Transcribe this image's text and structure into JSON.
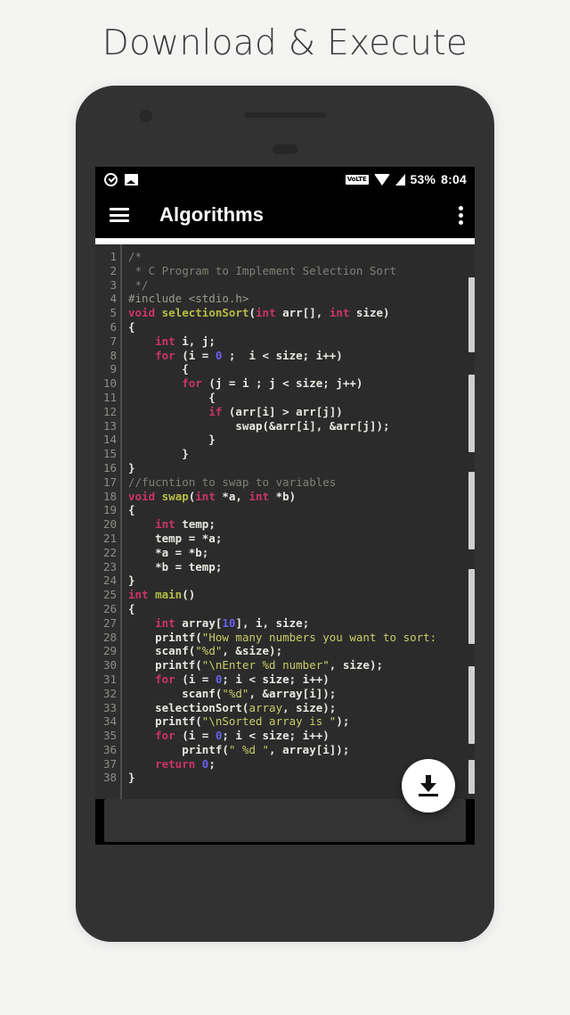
{
  "promo": {
    "title": "Download & Execute"
  },
  "device": {
    "camera_icon": "camera-dot",
    "speaker_icon": "speaker-grille",
    "sensor_icon": "proximity-sensor"
  },
  "statusbar": {
    "left_icons": [
      {
        "name": "check-circle-icon",
        "label": "task-complete"
      },
      {
        "name": "photo-icon",
        "label": "screenshot-saved"
      }
    ],
    "volte_badge": "VoLTE",
    "wifi_icon": "wifi-icon",
    "signal_icon": "signal-bars-icon",
    "battery": "53%",
    "time": "8:04"
  },
  "appbar": {
    "menu_icon": "hamburger-menu-icon",
    "title": "Algorithms",
    "overflow_icon": "overflow-menu-icon"
  },
  "fab": {
    "icon": "download-icon",
    "label": "Download"
  },
  "editor": {
    "language": "c",
    "first_line": 1,
    "last_line": 38,
    "line_numbers": [
      1,
      2,
      3,
      4,
      5,
      6,
      7,
      8,
      9,
      10,
      11,
      12,
      13,
      14,
      15,
      16,
      17,
      18,
      19,
      20,
      21,
      22,
      23,
      24,
      25,
      26,
      27,
      28,
      29,
      30,
      31,
      32,
      33,
      34,
      35,
      36,
      37,
      38
    ],
    "colors": {
      "background": "#2b2b2b",
      "gutter_background": "#2e2e2e",
      "gutter_text": "#8d8d87",
      "default_text": "#e8e8e2",
      "comment": "#808078",
      "preprocessor": "#9a9a92",
      "keyword": "#cc3366",
      "function": "#b5bd45",
      "string": "#c8cc68",
      "number": "#6b5ef0"
    },
    "lines": [
      [
        {
          "t": "/*",
          "c": "comment"
        }
      ],
      [
        {
          "t": " * C Program to Implement Selection Sort",
          "c": "comment"
        }
      ],
      [
        {
          "t": " */",
          "c": "comment"
        }
      ],
      [
        {
          "t": "#include <stdio.h>",
          "c": "preproc"
        }
      ],
      [
        {
          "t": "void ",
          "c": "kw"
        },
        {
          "t": "selectionSort",
          "c": "fn"
        },
        {
          "t": "(",
          "c": "plain"
        },
        {
          "t": "int",
          "c": "kw"
        },
        {
          "t": " arr[], ",
          "c": "plain"
        },
        {
          "t": "int",
          "c": "kw"
        },
        {
          "t": " size)",
          "c": "plain"
        }
      ],
      [
        {
          "t": "{",
          "c": "plain"
        }
      ],
      [
        {
          "t": "    ",
          "c": "plain"
        },
        {
          "t": "int",
          "c": "kw"
        },
        {
          "t": " i, j;",
          "c": "plain"
        }
      ],
      [
        {
          "t": "    ",
          "c": "plain"
        },
        {
          "t": "for",
          "c": "kw"
        },
        {
          "t": " (i = ",
          "c": "plain"
        },
        {
          "t": "0",
          "c": "num"
        },
        {
          "t": " ;  i < size; i++)",
          "c": "plain"
        }
      ],
      [
        {
          "t": "        {",
          "c": "plain"
        }
      ],
      [
        {
          "t": "        ",
          "c": "plain"
        },
        {
          "t": "for",
          "c": "kw"
        },
        {
          "t": " (j = i ; j < size; j++)",
          "c": "plain"
        }
      ],
      [
        {
          "t": "            {",
          "c": "plain"
        }
      ],
      [
        {
          "t": "            ",
          "c": "plain"
        },
        {
          "t": "if",
          "c": "kw"
        },
        {
          "t": " (arr[i] > arr[j])",
          "c": "plain"
        }
      ],
      [
        {
          "t": "                swap(&arr[i], &arr[j]);",
          "c": "plain"
        }
      ],
      [
        {
          "t": "            }",
          "c": "plain"
        }
      ],
      [
        {
          "t": "        }",
          "c": "plain"
        }
      ],
      [
        {
          "t": "}",
          "c": "plain"
        }
      ],
      [
        {
          "t": "//fucntion to swap to variables",
          "c": "comment"
        }
      ],
      [
        {
          "t": "void ",
          "c": "kw"
        },
        {
          "t": "swap",
          "c": "fn"
        },
        {
          "t": "(",
          "c": "plain"
        },
        {
          "t": "int",
          "c": "kw"
        },
        {
          "t": " *a, ",
          "c": "plain"
        },
        {
          "t": "int",
          "c": "kw"
        },
        {
          "t": " *b)",
          "c": "plain"
        }
      ],
      [
        {
          "t": "{",
          "c": "plain"
        }
      ],
      [
        {
          "t": "    ",
          "c": "plain"
        },
        {
          "t": "int",
          "c": "kw"
        },
        {
          "t": " temp;",
          "c": "plain"
        }
      ],
      [
        {
          "t": "    temp = *a;",
          "c": "plain"
        }
      ],
      [
        {
          "t": "    *a = *b;",
          "c": "plain"
        }
      ],
      [
        {
          "t": "    *b = temp;",
          "c": "plain"
        }
      ],
      [
        {
          "t": "}",
          "c": "plain"
        }
      ],
      [
        {
          "t": "int",
          "c": "kw"
        },
        {
          "t": " ",
          "c": "plain"
        },
        {
          "t": "main",
          "c": "fn"
        },
        {
          "t": "()",
          "c": "plain"
        }
      ],
      [
        {
          "t": "{",
          "c": "plain"
        }
      ],
      [
        {
          "t": "    ",
          "c": "plain"
        },
        {
          "t": "int",
          "c": "kw"
        },
        {
          "t": " array[",
          "c": "plain"
        },
        {
          "t": "10",
          "c": "num"
        },
        {
          "t": "], i, size;",
          "c": "plain"
        }
      ],
      [
        {
          "t": "    printf(",
          "c": "plain"
        },
        {
          "t": "\"How many numbers you want to sort: ",
          "c": "str"
        }
      ],
      [
        {
          "t": "    scanf(",
          "c": "plain"
        },
        {
          "t": "\"%d\"",
          "c": "str"
        },
        {
          "t": ", &size);",
          "c": "plain"
        }
      ],
      [
        {
          "t": "    printf(",
          "c": "plain"
        },
        {
          "t": "\"\\nEnter %d number\"",
          "c": "str"
        },
        {
          "t": ", size);",
          "c": "plain"
        }
      ],
      [
        {
          "t": "    ",
          "c": "plain"
        },
        {
          "t": "for",
          "c": "kw"
        },
        {
          "t": " (i = ",
          "c": "plain"
        },
        {
          "t": "0",
          "c": "num"
        },
        {
          "t": "; i < size; i++)",
          "c": "plain"
        }
      ],
      [
        {
          "t": "        scanf(",
          "c": "plain"
        },
        {
          "t": "\"%d\"",
          "c": "str"
        },
        {
          "t": ", &array[i]);",
          "c": "plain"
        }
      ],
      [
        {
          "t": "    selectionSort(",
          "c": "plain"
        },
        {
          "t": "array",
          "c": "str"
        },
        {
          "t": ", size);",
          "c": "plain"
        }
      ],
      [
        {
          "t": "    printf(",
          "c": "plain"
        },
        {
          "t": "\"\\nSorted array is \"",
          "c": "str"
        },
        {
          "t": ");",
          "c": "plain"
        }
      ],
      [
        {
          "t": "    ",
          "c": "plain"
        },
        {
          "t": "for",
          "c": "kw"
        },
        {
          "t": " (i = ",
          "c": "plain"
        },
        {
          "t": "0",
          "c": "num"
        },
        {
          "t": "; i < size; i++)",
          "c": "plain"
        }
      ],
      [
        {
          "t": "        printf(",
          "c": "plain"
        },
        {
          "t": "\" %d \"",
          "c": "str"
        },
        {
          "t": ", array[i]);",
          "c": "plain"
        }
      ],
      [
        {
          "t": "    ",
          "c": "plain"
        },
        {
          "t": "return",
          "c": "kw"
        },
        {
          "t": " ",
          "c": "plain"
        },
        {
          "t": "0",
          "c": "num"
        },
        {
          "t": ";",
          "c": "plain"
        }
      ],
      [
        {
          "t": "}",
          "c": "plain"
        }
      ]
    ],
    "scrollbar_segments": [
      {
        "top_pct": 6.0,
        "height_pct": 13.5
      },
      {
        "top_pct": 23.5,
        "height_pct": 14.0
      },
      {
        "top_pct": 41.0,
        "height_pct": 14.0
      },
      {
        "top_pct": 58.5,
        "height_pct": 13.5
      },
      {
        "top_pct": 76.0,
        "height_pct": 14.0
      },
      {
        "top_pct": 93.0,
        "height_pct": 6.0
      }
    ]
  }
}
